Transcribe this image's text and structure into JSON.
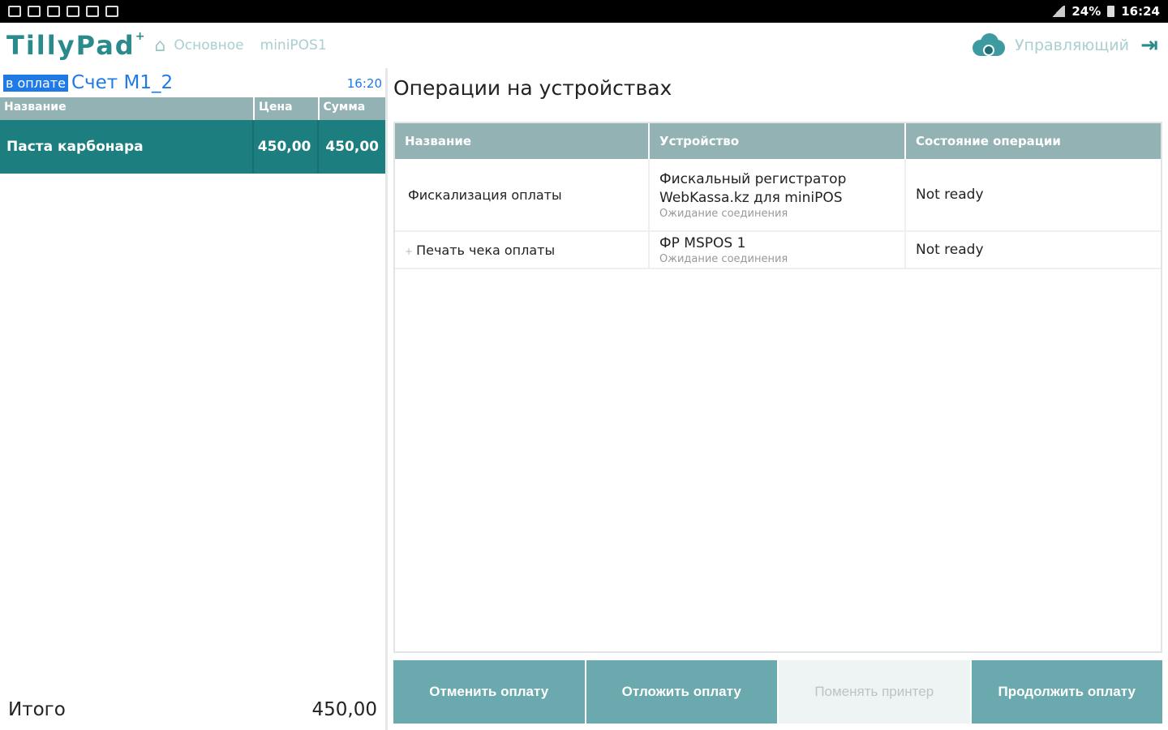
{
  "status_bar": {
    "battery": "24%",
    "time": "16:24",
    "notification_icons": [
      "notif-1-icon",
      "notif-2-icon",
      "notif-3-icon",
      "notif-4-icon",
      "notif-5-icon",
      "notif-6-icon"
    ]
  },
  "header": {
    "logo": "TillyPad",
    "breadcrumb": [
      "Основное",
      "miniPOS1"
    ],
    "user": "Управляющий"
  },
  "order": {
    "status_badge": "в оплате",
    "title": "Счет М1_2",
    "time": "16:20",
    "columns": [
      "Название",
      "Цена",
      "Сумма"
    ],
    "items": [
      {
        "name": "Паста карбонара",
        "price": "450,00",
        "sum": "450,00"
      }
    ],
    "total_label": "Итого",
    "total_value": "450,00"
  },
  "operations": {
    "title": "Операции на устройствах",
    "columns": [
      "Название",
      "Устройство",
      "Состояние операции"
    ],
    "rows": [
      {
        "prefix": "",
        "name": "Фискализация оплаты",
        "device": "Фискальный регистратор WebKassa.kz для miniPOS",
        "device_status": "Ожидание соединения",
        "state": "Not ready"
      },
      {
        "prefix": "+",
        "name": "Печать чека оплаты",
        "device": "ФР MSPOS 1",
        "device_status": "Ожидание соединения",
        "state": "Not ready"
      }
    ]
  },
  "actions": {
    "cancel": "Отменить оплату",
    "postpone": "Отложить оплату",
    "change_printer": "Поменять принтер",
    "continue": "Продолжить оплату"
  },
  "colors": {
    "accent": "#2a8a8c",
    "table_header": "#93b2b3",
    "selected_row": "#1c7e7e",
    "button": "#6aa9ad",
    "link_blue": "#1f7ae6"
  }
}
